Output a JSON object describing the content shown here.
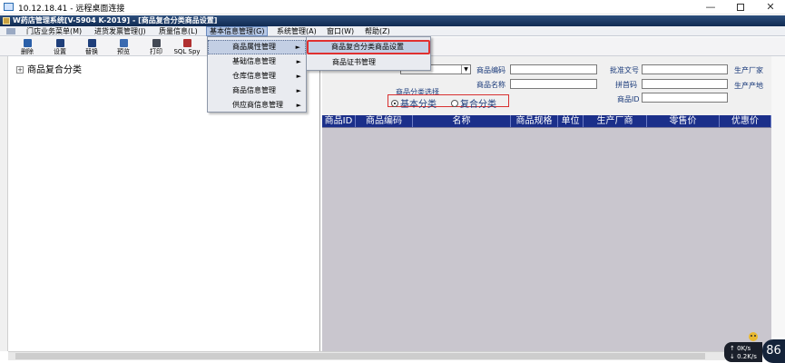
{
  "rdp": {
    "title": "10.12.18.41 - 远程桌面连接",
    "controls": {
      "minimize": "—",
      "close": "✕"
    }
  },
  "app": {
    "title": "W药店管理系统[V-5904 K-2019] - [商品复合分类商品设置]"
  },
  "menubar": [
    {
      "label": "门店业务菜单(M)"
    },
    {
      "label": "进货发票管理(J)"
    },
    {
      "label": "质量信息(L)"
    },
    {
      "label": "基本信息管理(G)"
    },
    {
      "label": "系统管理(A)"
    },
    {
      "label": "窗口(W)"
    },
    {
      "label": "帮助(Z)"
    }
  ],
  "toolbar": [
    {
      "label": "删除",
      "icon": "delete-icon",
      "color": "#2a5fa8"
    },
    {
      "label": "设置",
      "icon": "settings-icon",
      "color": "#1f3f7a"
    },
    {
      "label": "替换",
      "icon": "replace-icon",
      "color": "#1f3f7a"
    },
    {
      "label": "预览",
      "icon": "preview-icon",
      "color": "#3a6ab0"
    },
    {
      "label": "打印",
      "icon": "print-icon",
      "color": "#444a55"
    },
    {
      "label": "SQL Spy",
      "icon": "sql-spy-icon",
      "color": "#b03030"
    }
  ],
  "menu_level1": [
    {
      "label": "商品属性管理",
      "arrow": "►"
    },
    {
      "label": "基础信息管理",
      "arrow": "►"
    },
    {
      "label": "仓库信息管理",
      "arrow": "►"
    },
    {
      "label": "商品信息管理",
      "arrow": "►"
    },
    {
      "label": "供应商信息管理",
      "arrow": "►"
    }
  ],
  "menu_level2": [
    {
      "label": "商品复合分类商品设置"
    },
    {
      "label": "商品证书管理"
    }
  ],
  "tree": {
    "expander": "+",
    "root_label": "商品复合分类"
  },
  "filters": {
    "combo_arrow": "▼",
    "code_label": "商品编码",
    "name_label": "商品名称",
    "batch_label": "批准文号",
    "pinyin_label": "拼首码",
    "id_label": "商品ID",
    "maker_label": "生产厂家",
    "origin_label": "生产产地",
    "group_title": "商品分类选择",
    "radio_basic": "基本分类",
    "radio_compound": "复合分类"
  },
  "grid": {
    "columns": [
      "商品ID",
      "商品编码",
      "名称",
      "商品规格",
      "单位",
      "生产厂商",
      "零售价",
      "优惠价"
    ]
  },
  "net": {
    "up": "0K/s",
    "down": "0.2K/s",
    "cpu": "86"
  },
  "colors": {
    "grid_header": "#1b2f8a",
    "grid_body": "#c9c6ce",
    "highlight_border": "#e03030",
    "app_title_bar": "#1b365f"
  }
}
